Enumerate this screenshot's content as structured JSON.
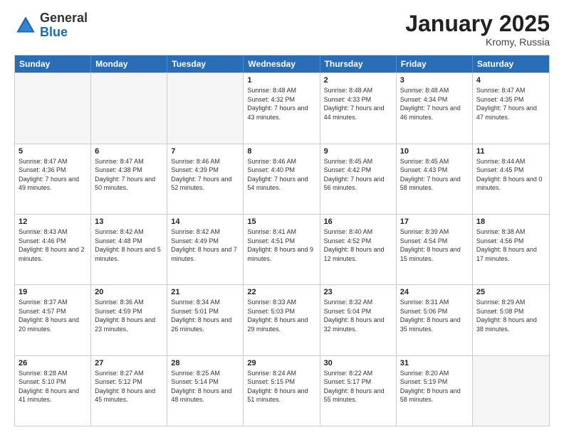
{
  "header": {
    "logo_general": "General",
    "logo_blue": "Blue",
    "month_title": "January 2025",
    "location": "Kromy, Russia"
  },
  "days_of_week": [
    "Sunday",
    "Monday",
    "Tuesday",
    "Wednesday",
    "Thursday",
    "Friday",
    "Saturday"
  ],
  "rows": [
    [
      {
        "day": "",
        "sunrise": "",
        "sunset": "",
        "daylight": "",
        "shaded": true
      },
      {
        "day": "",
        "sunrise": "",
        "sunset": "",
        "daylight": "",
        "shaded": true
      },
      {
        "day": "",
        "sunrise": "",
        "sunset": "",
        "daylight": "",
        "shaded": true
      },
      {
        "day": "1",
        "sunrise": "Sunrise: 8:48 AM",
        "sunset": "Sunset: 4:32 PM",
        "daylight": "Daylight: 7 hours and 43 minutes.",
        "shaded": false
      },
      {
        "day": "2",
        "sunrise": "Sunrise: 8:48 AM",
        "sunset": "Sunset: 4:33 PM",
        "daylight": "Daylight: 7 hours and 44 minutes.",
        "shaded": false
      },
      {
        "day": "3",
        "sunrise": "Sunrise: 8:48 AM",
        "sunset": "Sunset: 4:34 PM",
        "daylight": "Daylight: 7 hours and 46 minutes.",
        "shaded": false
      },
      {
        "day": "4",
        "sunrise": "Sunrise: 8:47 AM",
        "sunset": "Sunset: 4:35 PM",
        "daylight": "Daylight: 7 hours and 47 minutes.",
        "shaded": false
      }
    ],
    [
      {
        "day": "5",
        "sunrise": "Sunrise: 8:47 AM",
        "sunset": "Sunset: 4:36 PM",
        "daylight": "Daylight: 7 hours and 49 minutes.",
        "shaded": false
      },
      {
        "day": "6",
        "sunrise": "Sunrise: 8:47 AM",
        "sunset": "Sunset: 4:38 PM",
        "daylight": "Daylight: 7 hours and 50 minutes.",
        "shaded": false
      },
      {
        "day": "7",
        "sunrise": "Sunrise: 8:46 AM",
        "sunset": "Sunset: 4:39 PM",
        "daylight": "Daylight: 7 hours and 52 minutes.",
        "shaded": false
      },
      {
        "day": "8",
        "sunrise": "Sunrise: 8:46 AM",
        "sunset": "Sunset: 4:40 PM",
        "daylight": "Daylight: 7 hours and 54 minutes.",
        "shaded": false
      },
      {
        "day": "9",
        "sunrise": "Sunrise: 8:45 AM",
        "sunset": "Sunset: 4:42 PM",
        "daylight": "Daylight: 7 hours and 56 minutes.",
        "shaded": false
      },
      {
        "day": "10",
        "sunrise": "Sunrise: 8:45 AM",
        "sunset": "Sunset: 4:43 PM",
        "daylight": "Daylight: 7 hours and 58 minutes.",
        "shaded": false
      },
      {
        "day": "11",
        "sunrise": "Sunrise: 8:44 AM",
        "sunset": "Sunset: 4:45 PM",
        "daylight": "Daylight: 8 hours and 0 minutes.",
        "shaded": false
      }
    ],
    [
      {
        "day": "12",
        "sunrise": "Sunrise: 8:43 AM",
        "sunset": "Sunset: 4:46 PM",
        "daylight": "Daylight: 8 hours and 2 minutes.",
        "shaded": false
      },
      {
        "day": "13",
        "sunrise": "Sunrise: 8:42 AM",
        "sunset": "Sunset: 4:48 PM",
        "daylight": "Daylight: 8 hours and 5 minutes.",
        "shaded": false
      },
      {
        "day": "14",
        "sunrise": "Sunrise: 8:42 AM",
        "sunset": "Sunset: 4:49 PM",
        "daylight": "Daylight: 8 hours and 7 minutes.",
        "shaded": false
      },
      {
        "day": "15",
        "sunrise": "Sunrise: 8:41 AM",
        "sunset": "Sunset: 4:51 PM",
        "daylight": "Daylight: 8 hours and 9 minutes.",
        "shaded": false
      },
      {
        "day": "16",
        "sunrise": "Sunrise: 8:40 AM",
        "sunset": "Sunset: 4:52 PM",
        "daylight": "Daylight: 8 hours and 12 minutes.",
        "shaded": false
      },
      {
        "day": "17",
        "sunrise": "Sunrise: 8:39 AM",
        "sunset": "Sunset: 4:54 PM",
        "daylight": "Daylight: 8 hours and 15 minutes.",
        "shaded": false
      },
      {
        "day": "18",
        "sunrise": "Sunrise: 8:38 AM",
        "sunset": "Sunset: 4:56 PM",
        "daylight": "Daylight: 8 hours and 17 minutes.",
        "shaded": false
      }
    ],
    [
      {
        "day": "19",
        "sunrise": "Sunrise: 8:37 AM",
        "sunset": "Sunset: 4:57 PM",
        "daylight": "Daylight: 8 hours and 20 minutes.",
        "shaded": false
      },
      {
        "day": "20",
        "sunrise": "Sunrise: 8:36 AM",
        "sunset": "Sunset: 4:59 PM",
        "daylight": "Daylight: 8 hours and 23 minutes.",
        "shaded": false
      },
      {
        "day": "21",
        "sunrise": "Sunrise: 8:34 AM",
        "sunset": "Sunset: 5:01 PM",
        "daylight": "Daylight: 8 hours and 26 minutes.",
        "shaded": false
      },
      {
        "day": "22",
        "sunrise": "Sunrise: 8:33 AM",
        "sunset": "Sunset: 5:03 PM",
        "daylight": "Daylight: 8 hours and 29 minutes.",
        "shaded": false
      },
      {
        "day": "23",
        "sunrise": "Sunrise: 8:32 AM",
        "sunset": "Sunset: 5:04 PM",
        "daylight": "Daylight: 8 hours and 32 minutes.",
        "shaded": false
      },
      {
        "day": "24",
        "sunrise": "Sunrise: 8:31 AM",
        "sunset": "Sunset: 5:06 PM",
        "daylight": "Daylight: 8 hours and 35 minutes.",
        "shaded": false
      },
      {
        "day": "25",
        "sunrise": "Sunrise: 8:29 AM",
        "sunset": "Sunset: 5:08 PM",
        "daylight": "Daylight: 8 hours and 38 minutes.",
        "shaded": false
      }
    ],
    [
      {
        "day": "26",
        "sunrise": "Sunrise: 8:28 AM",
        "sunset": "Sunset: 5:10 PM",
        "daylight": "Daylight: 8 hours and 41 minutes.",
        "shaded": false
      },
      {
        "day": "27",
        "sunrise": "Sunrise: 8:27 AM",
        "sunset": "Sunset: 5:12 PM",
        "daylight": "Daylight: 8 hours and 45 minutes.",
        "shaded": false
      },
      {
        "day": "28",
        "sunrise": "Sunrise: 8:25 AM",
        "sunset": "Sunset: 5:14 PM",
        "daylight": "Daylight: 8 hours and 48 minutes.",
        "shaded": false
      },
      {
        "day": "29",
        "sunrise": "Sunrise: 8:24 AM",
        "sunset": "Sunset: 5:15 PM",
        "daylight": "Daylight: 8 hours and 51 minutes.",
        "shaded": false
      },
      {
        "day": "30",
        "sunrise": "Sunrise: 8:22 AM",
        "sunset": "Sunset: 5:17 PM",
        "daylight": "Daylight: 8 hours and 55 minutes.",
        "shaded": false
      },
      {
        "day": "31",
        "sunrise": "Sunrise: 8:20 AM",
        "sunset": "Sunset: 5:19 PM",
        "daylight": "Daylight: 8 hours and 58 minutes.",
        "shaded": false
      },
      {
        "day": "",
        "sunrise": "",
        "sunset": "",
        "daylight": "",
        "shaded": true
      }
    ]
  ]
}
